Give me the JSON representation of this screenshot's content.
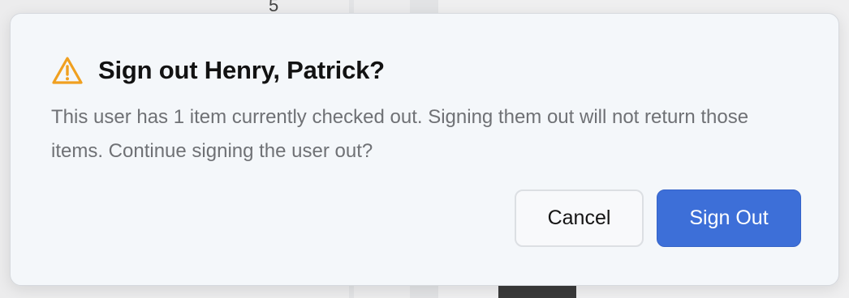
{
  "background": {
    "digit": "5"
  },
  "dialog": {
    "title": "Sign out Henry, Patrick?",
    "message": "This user has 1 item currently checked out. Signing them out will not return those items. Continue signing the user out?",
    "icon": "warning-triangle-icon",
    "buttons": {
      "cancel_label": "Cancel",
      "confirm_label": "Sign Out"
    }
  },
  "colors": {
    "accent": "#3d6fd8",
    "warning": "#f0a020",
    "title_text": "#121212",
    "body_text": "#6f7175",
    "dialog_bg": "#f4f7fa"
  }
}
